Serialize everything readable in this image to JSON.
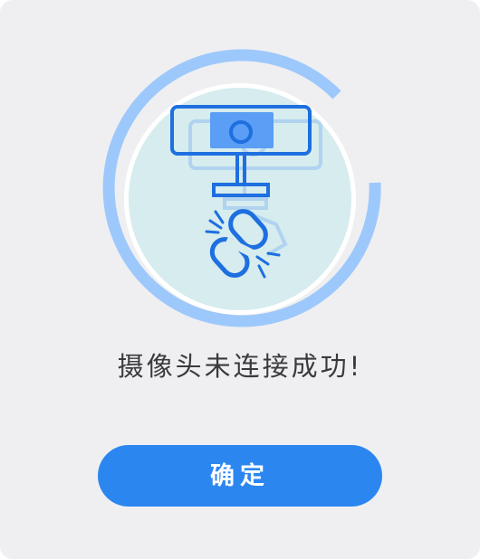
{
  "dialog": {
    "message": "摄像头未连接成功!",
    "confirm_label": "确定",
    "illustration_icon": "camera-disconnected-icon"
  },
  "colors": {
    "background": "#efeff2",
    "accent": "#2b86f0",
    "ring": "#9dc8fb",
    "disc": "#d6ecee",
    "icon_stroke": "#1e6fe0",
    "icon_fill": "#5a9ef5"
  }
}
